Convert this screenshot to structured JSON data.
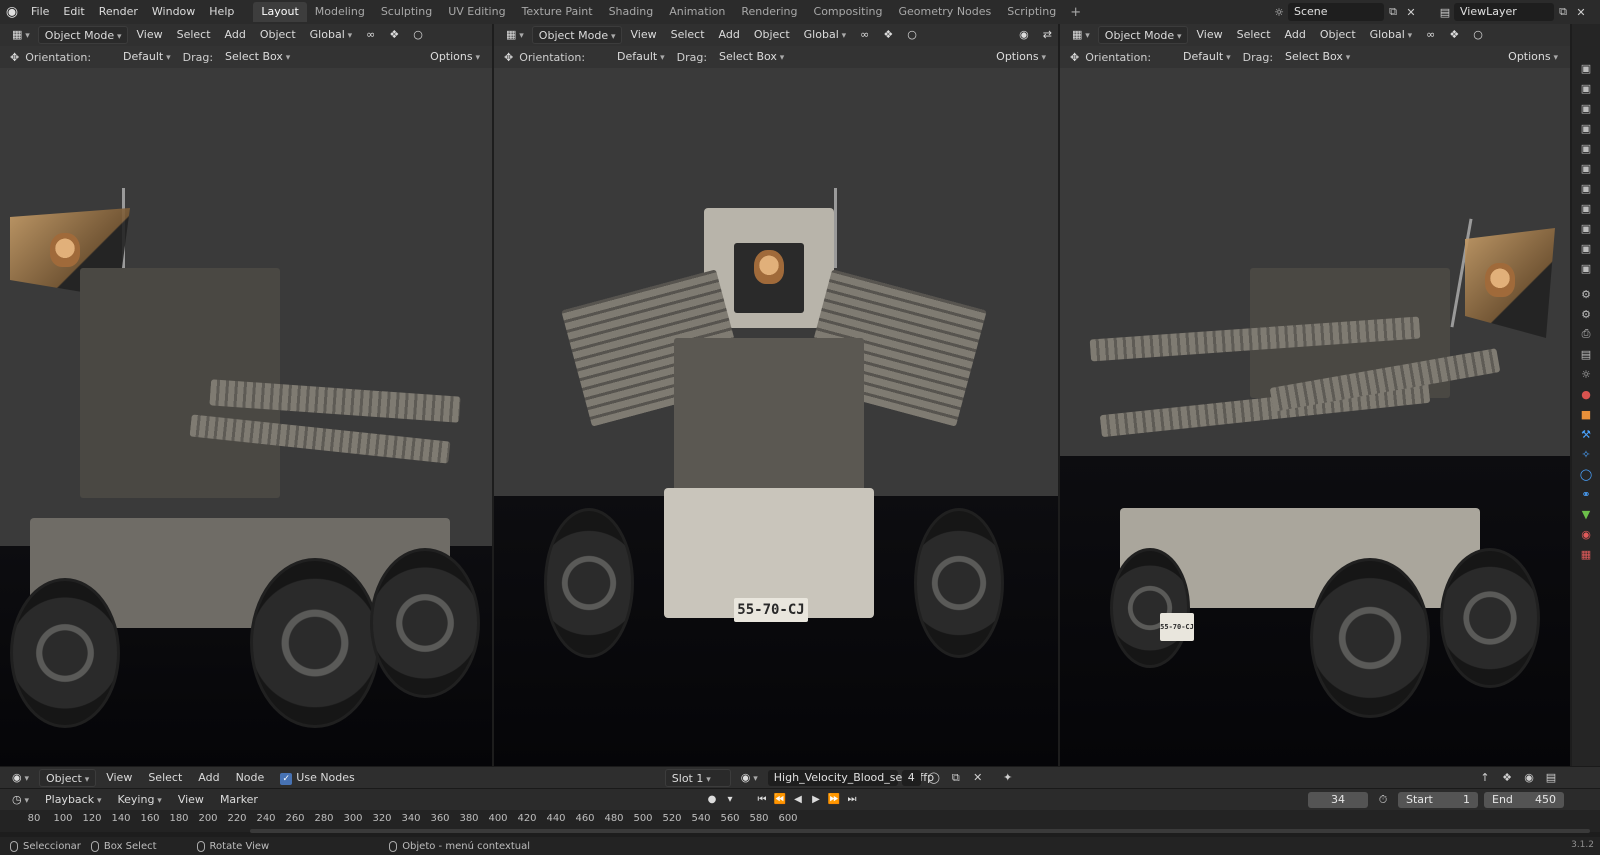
{
  "menu": [
    "File",
    "Edit",
    "Render",
    "Window",
    "Help"
  ],
  "workspaces": [
    "Layout",
    "Modeling",
    "Sculpting",
    "UV Editing",
    "Texture Paint",
    "Shading",
    "Animation",
    "Rendering",
    "Compositing",
    "Geometry Nodes",
    "Scripting"
  ],
  "scene": "Scene",
  "view_layer": "ViewLayer",
  "viewport": {
    "mode": "Object Mode",
    "menus": [
      "View",
      "Select",
      "Add",
      "Object"
    ],
    "transform": "Global",
    "orientation_label": "Orientation:",
    "orientation_value": "Default",
    "drag_label": "Drag:",
    "drag_value": "Select Box",
    "options": "Options"
  },
  "license_plate": "55-70-CJ",
  "shader_header": {
    "mode": "Object",
    "menus": [
      "View",
      "Select",
      "Add",
      "Node"
    ],
    "use_nodes": "Use Nodes",
    "slot": "Slot 1",
    "material": "High_Velocity_Blood_se1kfffp",
    "users": "4"
  },
  "timeline": {
    "menus": [
      "Playback",
      "Keying",
      "View",
      "Marker"
    ],
    "current_frame": "34",
    "start_label": "Start",
    "start": "1",
    "end_label": "End",
    "end": "450",
    "ticks": [
      "80",
      "100",
      "120",
      "140",
      "160",
      "180",
      "200",
      "220",
      "240",
      "260",
      "280",
      "300",
      "320",
      "340",
      "360",
      "380",
      "400",
      "420",
      "440",
      "460",
      "480",
      "500",
      "520",
      "540",
      "560",
      "580",
      "600"
    ]
  },
  "status": {
    "select": "Seleccionar",
    "box_select": "Box Select",
    "rotate_view": "Rotate View",
    "context_menu": "Objeto - menú contextual",
    "version": "3.1.2"
  }
}
